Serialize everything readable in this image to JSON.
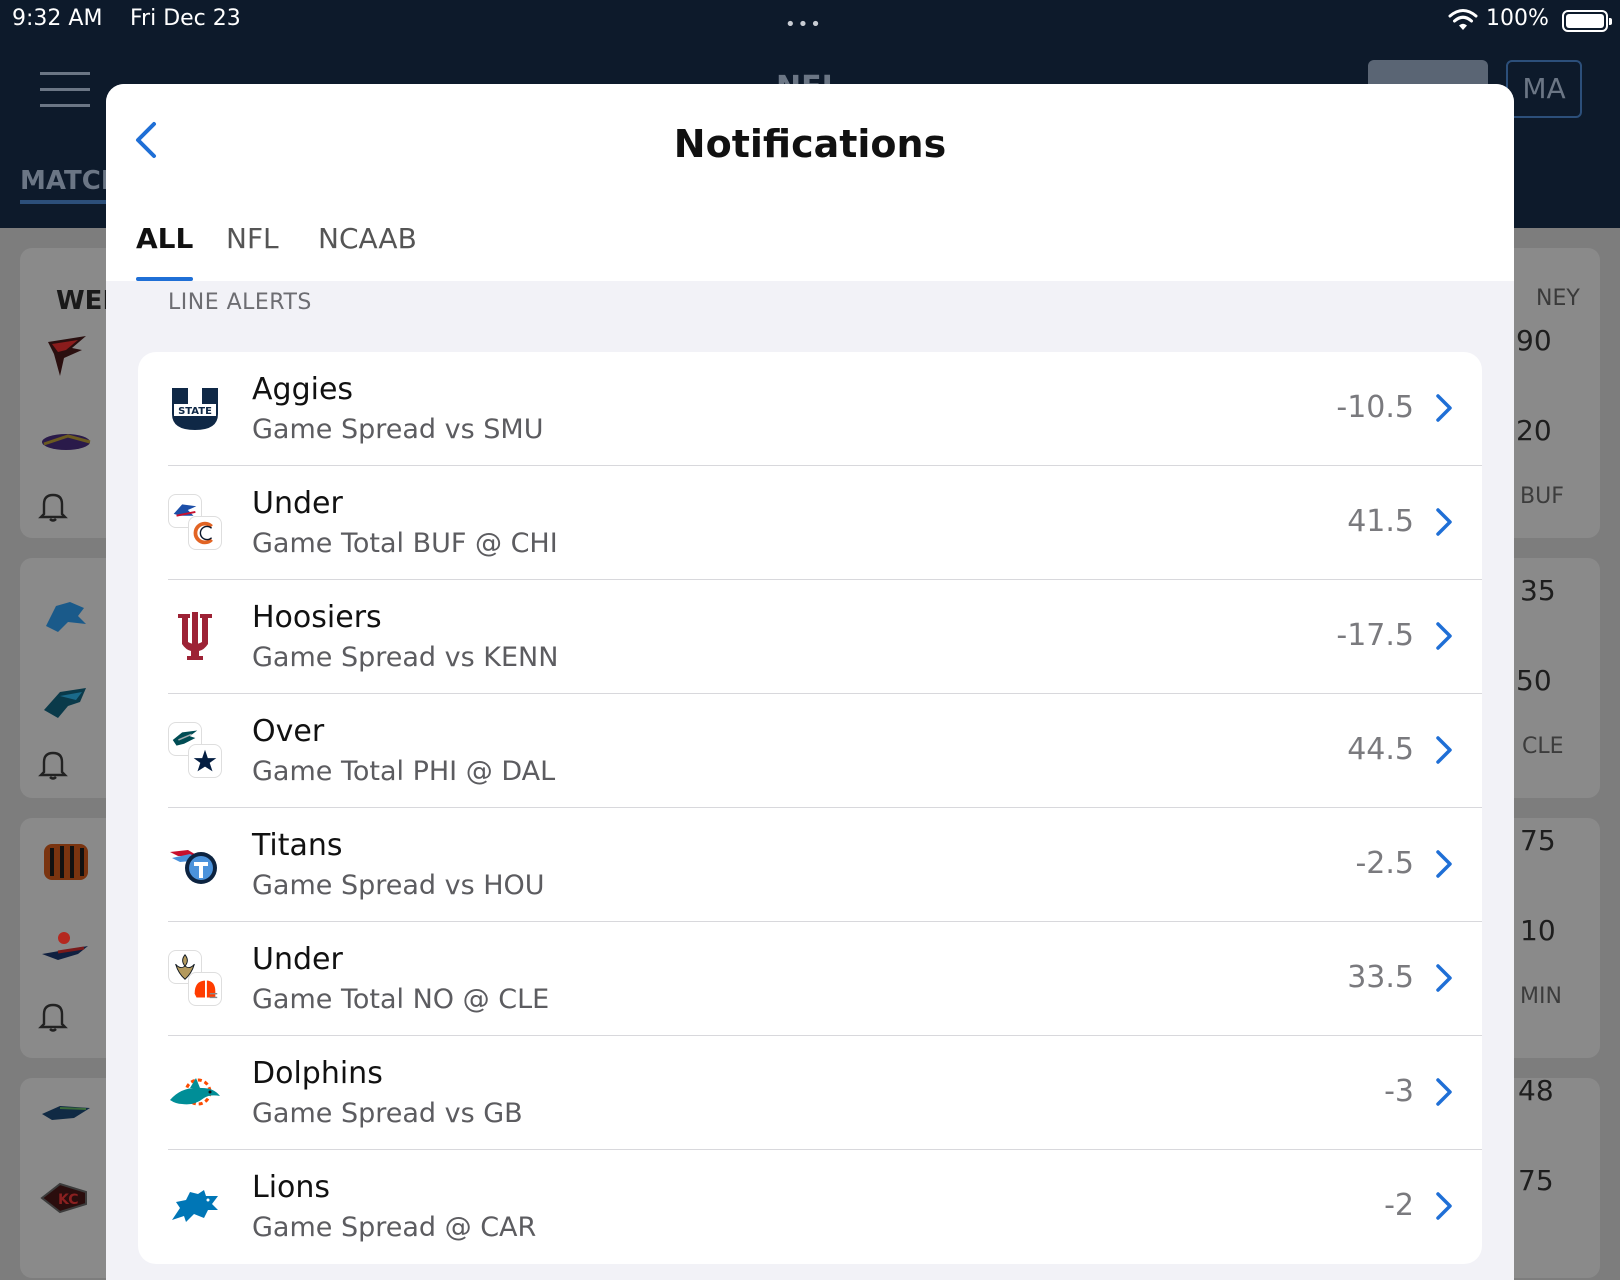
{
  "status_bar": {
    "time": "9:32 AM",
    "date": "Fri Dec 23",
    "battery_percent": "100%",
    "multitask_dots": "•••"
  },
  "background_app": {
    "title": "NFL",
    "match_tab": "MATCH",
    "week_label": "WEEK",
    "money_label": "NEY",
    "profile_button": "MA",
    "side_values": [
      "90",
      "20",
      "BUF",
      "35",
      "50",
      "CLE",
      "75",
      "10",
      "MIN",
      "48",
      "75"
    ],
    "bell_labels": [
      "S",
      "S",
      "S"
    ]
  },
  "modal": {
    "title": "Notifications",
    "tabs": [
      {
        "label": "ALL",
        "active": true
      },
      {
        "label": "NFL",
        "active": false
      },
      {
        "label": "NCAAB",
        "active": false
      }
    ],
    "section_label": "LINE ALERTS",
    "alerts": [
      {
        "title": "Aggies",
        "subtitle": "Game Spread vs SMU",
        "value": "-10.5",
        "logo": "utah-state-logo-icon"
      },
      {
        "title": "Under",
        "subtitle": "Game Total BUF @ CHI",
        "value": "41.5",
        "logo": "bills-bears-logos-icon"
      },
      {
        "title": "Hoosiers",
        "subtitle": "Game Spread vs KENN",
        "value": "-17.5",
        "logo": "indiana-logo-icon"
      },
      {
        "title": "Over",
        "subtitle": "Game Total PHI @ DAL",
        "value": "44.5",
        "logo": "eagles-cowboys-logos-icon"
      },
      {
        "title": "Titans",
        "subtitle": "Game Spread vs HOU",
        "value": "-2.5",
        "logo": "titans-logo-icon"
      },
      {
        "title": "Under",
        "subtitle": "Game Total NO @ CLE",
        "value": "33.5",
        "logo": "saints-browns-logos-icon"
      },
      {
        "title": "Dolphins",
        "subtitle": "Game Spread vs GB",
        "value": "-3",
        "logo": "dolphins-logo-icon"
      },
      {
        "title": "Lions",
        "subtitle": "Game Spread @ CAR",
        "value": "-2",
        "logo": "lions-logo-icon"
      }
    ]
  },
  "colors": {
    "accent": "#1f6fd6",
    "header_bg": "#0d1a2b",
    "modal_bg": "#f2f2f7"
  }
}
